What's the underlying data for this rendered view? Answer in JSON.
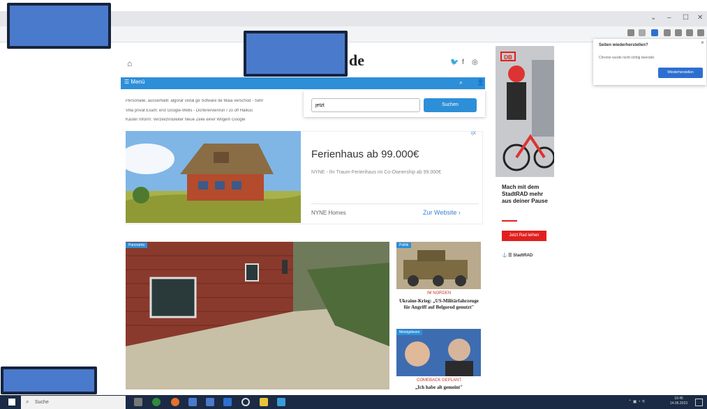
{
  "site": {
    "logo_suffix": "de",
    "social_icons": [
      "twitter-icon",
      "facebook-icon",
      "instagram-icon"
    ],
    "nav_menu_label": "Menü",
    "ticker": [
      "Personalie, ausserhalb: algorar vistal ge Sofware de Maia verschod - Sehr",
      "Villa privat Exam: erst Google-Wells - Dorterervienrun / Jo off Halkus",
      "Kaster Inform: Verzeichnisleiter Neue Zeile einer Wilgem Google"
    ]
  },
  "search": {
    "value": "jetzt",
    "button_label": "Suchen"
  },
  "ad": {
    "title": "Ferienhaus ab 99.000€",
    "description": "NYNE - Ihr Traum-Ferienhaus im Co-Ownership ab 99.000€",
    "brand": "NYNE Homes",
    "link": "Zur Website ›",
    "badge": "i|X"
  },
  "articles": {
    "main_tag": "Panorama",
    "side1_tag": "Politik",
    "side1_kicker": "IM NORDEN",
    "side1_title": "Ukraine-Krieg: „US-Militärfahrzeuge für Angriff auf Belgorod genutzt\"",
    "side2_tag": "Meistgelesen",
    "side2_kicker": "COMEBACK GEPLANT",
    "side2_title": "„Ich habe alt gemeint\""
  },
  "sidebar_ad": {
    "brand": "DB",
    "title": "Mach mit dem StadtRAD mehr aus deiner Pause",
    "button": "Jetzt Rad leihen",
    "footer": "StadtRAD"
  },
  "notification": {
    "title": "Seiten wiederherstellen?",
    "body": "Chrome wurde nicht richtig beendet.",
    "button": "Wiederherstellen"
  },
  "taskbar": {
    "search_placeholder": "Suche",
    "time": "16:45",
    "date": "14.06.2023"
  },
  "colors": {
    "nav": "#2d8fd8",
    "taskbar": "#1b2b45",
    "redaction": "#4a7acb",
    "db_red": "#e0201e"
  }
}
